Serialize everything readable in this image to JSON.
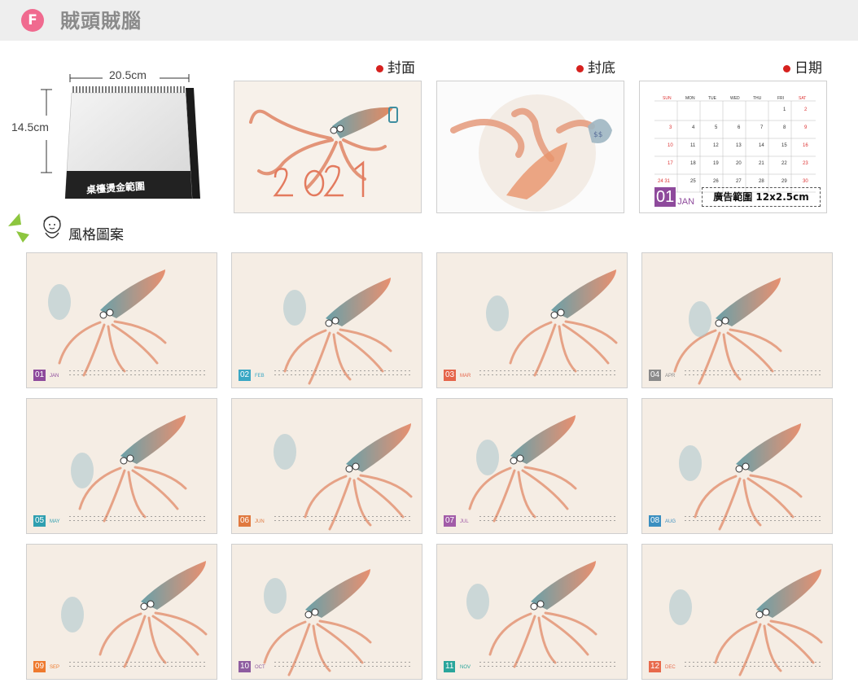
{
  "header": {
    "badge": "F",
    "title": "賊頭賊腦"
  },
  "desk": {
    "width_text": "20.5cm",
    "height_text": "14.5cm",
    "base_text": "桌檯燙金範圍"
  },
  "previews": [
    {
      "label": "封面"
    },
    {
      "label": "封底"
    },
    {
      "label": "日期"
    }
  ],
  "date_page": {
    "weekdays": [
      "SUN",
      "MON",
      "TUE",
      "WED",
      "THU",
      "FRI",
      "SAT"
    ],
    "month_num": "01",
    "month_abbr": "JAN",
    "ad_text": "廣告範圍 12x2.5cm"
  },
  "style_section": {
    "label": "風格圖案"
  },
  "months": [
    {
      "num": "01",
      "abbr": "JAN",
      "color": "#8e4a9c"
    },
    {
      "num": "02",
      "abbr": "FEB",
      "color": "#3aa7c4"
    },
    {
      "num": "03",
      "abbr": "MAR",
      "color": "#e5654a"
    },
    {
      "num": "04",
      "abbr": "APR",
      "color": "#8a8a8a"
    },
    {
      "num": "05",
      "abbr": "MAY",
      "color": "#2f9fb0"
    },
    {
      "num": "06",
      "abbr": "JUN",
      "color": "#e0793f"
    },
    {
      "num": "07",
      "abbr": "JUL",
      "color": "#a25ca8"
    },
    {
      "num": "08",
      "abbr": "AUG",
      "color": "#3b8fc0"
    },
    {
      "num": "09",
      "abbr": "SEP",
      "color": "#ee7a2e"
    },
    {
      "num": "10",
      "abbr": "OCT",
      "color": "#8e5ca0"
    },
    {
      "num": "11",
      "abbr": "NOV",
      "color": "#2aa59b"
    },
    {
      "num": "12",
      "abbr": "DEC",
      "color": "#e86a4c"
    }
  ],
  "colors": {
    "accent_pink": "#f06a8f",
    "dot_red": "#d6211e",
    "squid_teal": "#6aa0a8",
    "squid_orange": "#e89070"
  }
}
